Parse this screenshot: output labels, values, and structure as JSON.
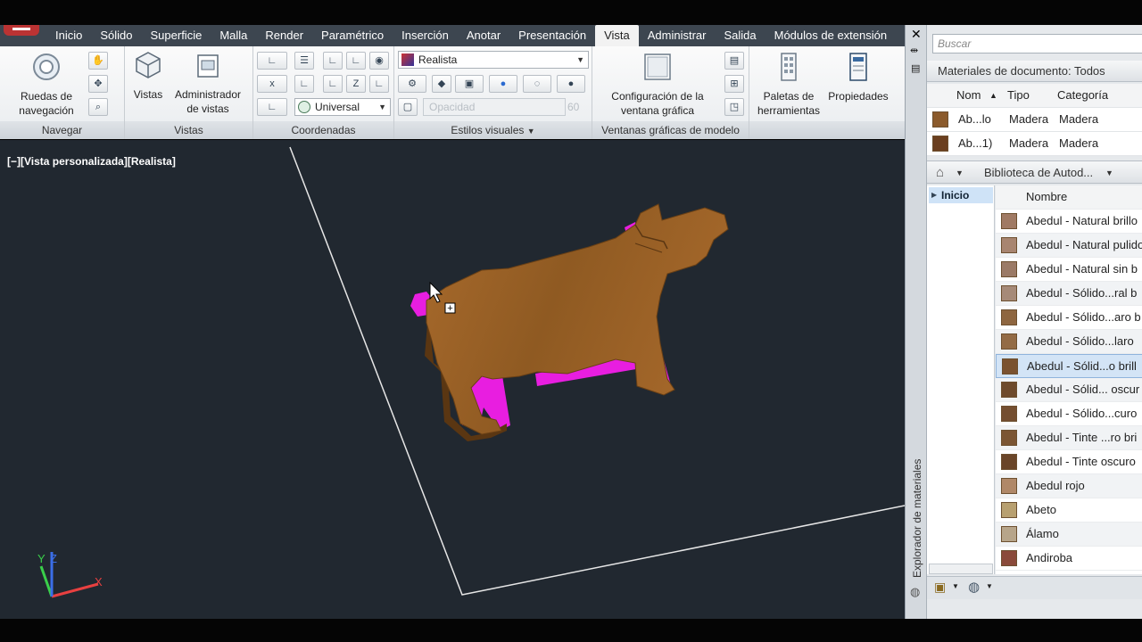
{
  "ribbon": {
    "tabs": [
      {
        "label": "Inicio"
      },
      {
        "label": "Sólido"
      },
      {
        "label": "Superficie"
      },
      {
        "label": "Malla"
      },
      {
        "label": "Render"
      },
      {
        "label": "Paramétrico"
      },
      {
        "label": "Inserción"
      },
      {
        "label": "Anotar"
      },
      {
        "label": "Presentación"
      },
      {
        "label": "Vista",
        "active": true
      },
      {
        "label": "Administrar"
      },
      {
        "label": "Salida"
      },
      {
        "label": "Módulos de extensión"
      }
    ],
    "navegar": {
      "title": "Navegar",
      "wheels_label_1": "Ruedas de",
      "wheels_label_2": "navegación"
    },
    "vistas": {
      "title": "Vistas",
      "views_label": "Vistas",
      "manager_label_1": "Administrador",
      "manager_label_2": "de vistas"
    },
    "coordenadas": {
      "title": "Coordenadas",
      "ucs_combo": "Universal"
    },
    "estilos": {
      "title": "Estilos visuales",
      "style_combo": "Realista",
      "opacity_label": "Opacidad",
      "opacity_value": "60"
    },
    "ventanas": {
      "title": "Ventanas gráficas de modelo",
      "config_label_1": "Configuración de la",
      "config_label_2": "ventana gráfica"
    },
    "paletas": {
      "palettes_label_1": "Paletas de",
      "palettes_label_2": "herramientas",
      "props_label": "Propiedades"
    }
  },
  "viewport": {
    "label": "[−][Vista personalizada][Realista]",
    "axis_x": "X",
    "axis_y": "Y",
    "axis_z": "Z",
    "colors": {
      "background": "#212830",
      "wood": "#9a5f25",
      "edge": "#ff00ff"
    }
  },
  "palette": {
    "vertical_title": "Explorador de materiales",
    "search_placeholder": "Buscar",
    "doc_materials_header": "Materiales de documento: Todos",
    "doc_columns": [
      "Nom",
      "Tipo",
      "Categoría"
    ],
    "doc_rows": [
      {
        "name": "Ab...lo",
        "type": "Madera",
        "category": "Madera",
        "color": "#8b5a2b"
      },
      {
        "name": "Ab...1)",
        "type": "Madera",
        "category": "Madera",
        "color": "#6b3f1f"
      }
    ],
    "library_breadcrumb": "Biblioteca de Autod...",
    "tree_item": "Inicio",
    "list_column": "Nombre",
    "list_rows": [
      {
        "name": "Abedul - Natural brillo",
        "color": "#a07a64"
      },
      {
        "name": "Abedul - Natural pulido",
        "color": "#a88570"
      },
      {
        "name": "Abedul - Natural sin b",
        "color": "#9b7a66"
      },
      {
        "name": "Abedul - Sólido...ral b",
        "color": "#a68a78"
      },
      {
        "name": "Abedul - Sólido...aro b",
        "color": "#8e6640"
      },
      {
        "name": "Abedul - Sólido...laro",
        "color": "#936b45"
      },
      {
        "name": "Abedul - Sólid...o brill",
        "color": "#7a5230",
        "selected": true
      },
      {
        "name": "Abedul - Sólid... oscur",
        "color": "#6e4a2c"
      },
      {
        "name": "Abedul - Sólido...curo",
        "color": "#744e30"
      },
      {
        "name": "Abedul - Tinte ...ro bri",
        "color": "#7b5533"
      },
      {
        "name": "Abedul - Tinte oscuro",
        "color": "#6a4528"
      },
      {
        "name": "Abedul rojo",
        "color": "#b08868"
      },
      {
        "name": "Abeto",
        "color": "#b8a070"
      },
      {
        "name": "Álamo",
        "color": "#b7a58a"
      },
      {
        "name": "Andiroba",
        "color": "#8a4a3a"
      }
    ]
  }
}
